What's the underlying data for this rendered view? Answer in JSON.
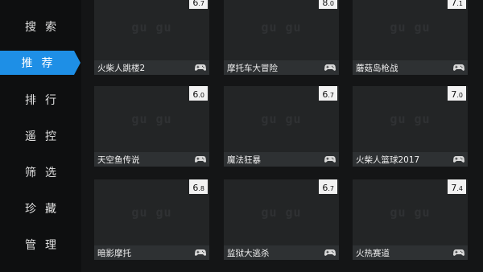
{
  "sidebar": {
    "items": [
      {
        "label": "搜索"
      },
      {
        "label": "推荐"
      },
      {
        "label": "排行"
      },
      {
        "label": "遥控"
      },
      {
        "label": "筛选"
      },
      {
        "label": "珍藏"
      },
      {
        "label": "管理"
      }
    ],
    "active": "推荐"
  },
  "cards": [
    {
      "title": "火柴人跳楼2",
      "score_int": "6",
      "score_dec": ".7"
    },
    {
      "title": "摩托车大冒险",
      "score_int": "8",
      "score_dec": ".0"
    },
    {
      "title": "蘑菇岛枪战",
      "score_int": "7",
      "score_dec": ".1"
    },
    {
      "title": "天空鱼传说",
      "score_int": "6",
      "score_dec": ".0"
    },
    {
      "title": "魔法狂暴",
      "score_int": "6",
      "score_dec": ".7"
    },
    {
      "title": "火柴人篮球2017",
      "score_int": "7",
      "score_dec": ".0"
    },
    {
      "title": "暗影摩托",
      "score_int": "6",
      "score_dec": ".8"
    },
    {
      "title": "监狱大逃杀",
      "score_int": "6",
      "score_dec": ".7"
    },
    {
      "title": "火热赛道",
      "score_int": "7",
      "score_dec": ".4"
    }
  ],
  "watermark": "gu gu",
  "colors": {
    "accent": "#1e8fe6",
    "sidebar_bg": "#0e0f10",
    "card_bg": "#232526"
  },
  "icons": {
    "card_badge": "gamepad-icon"
  }
}
